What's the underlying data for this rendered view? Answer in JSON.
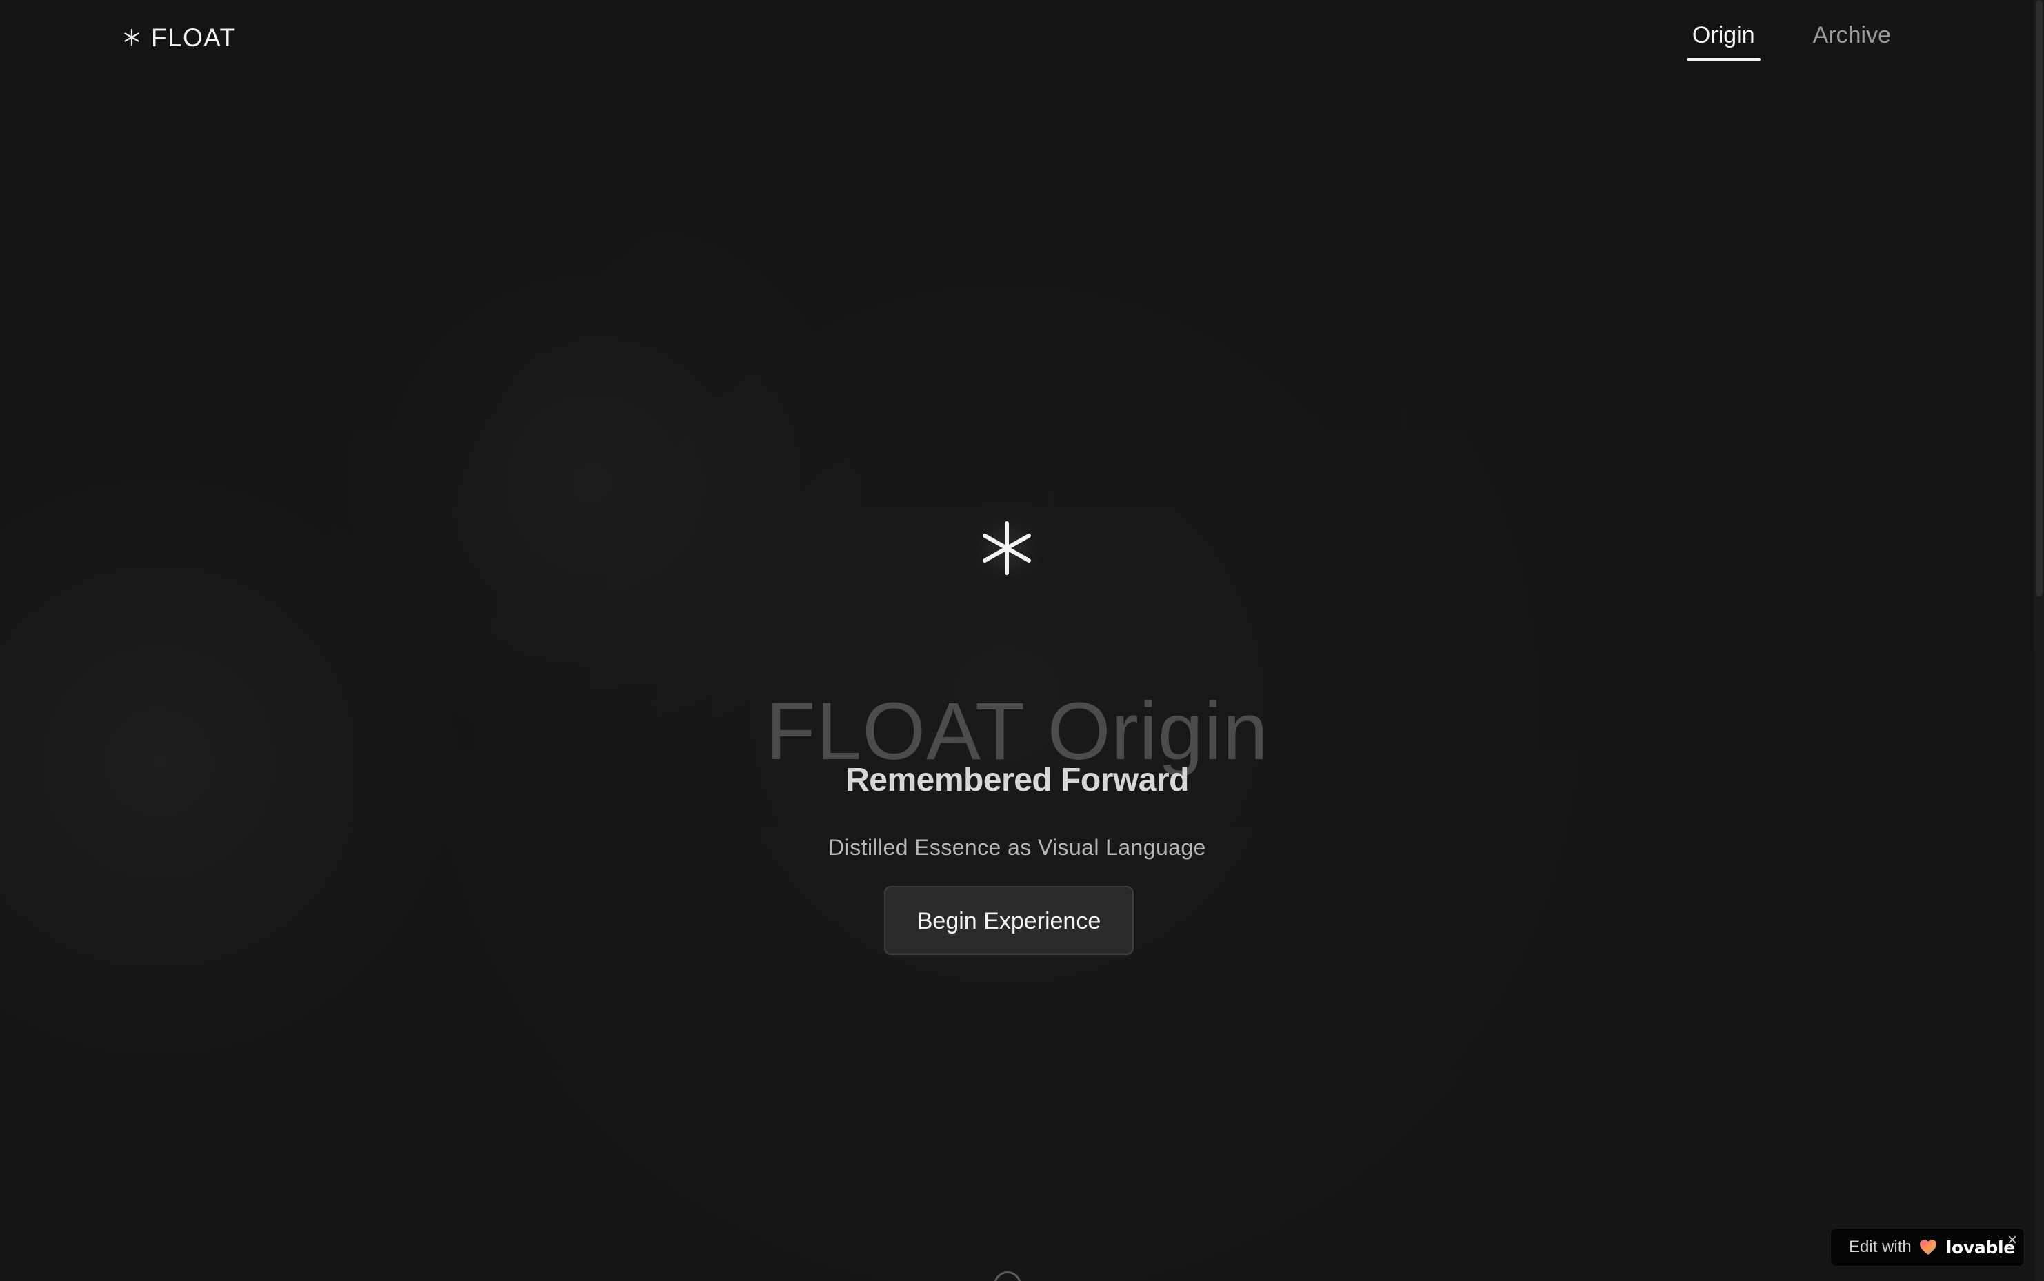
{
  "header": {
    "brand": "FLOAT",
    "brand_icon": "asterisk-icon",
    "nav": [
      {
        "label": "Origin",
        "active": true
      },
      {
        "label": "Archive",
        "active": false
      }
    ]
  },
  "hero": {
    "icon": "asterisk-icon",
    "title": "FLOAT Origin",
    "subtitle": "Remembered Forward",
    "tagline": "Distilled Essence as Visual Language",
    "cta_label": "Begin Experience"
  },
  "badge": {
    "prefix": "Edit with",
    "brand": "lovable",
    "icon": "heart-icon",
    "close_icon": "close-icon",
    "close_label": "×"
  },
  "scroll_indicator_icon": "scroll-indicator-icon",
  "colors": {
    "background": "#141414",
    "text_primary": "#f3f3f3",
    "text_secondary": "#b6b6b6",
    "nav_inactive": "#9b9b9b",
    "button_background": "#2a2a2a",
    "button_border": "#3f3f3f"
  }
}
